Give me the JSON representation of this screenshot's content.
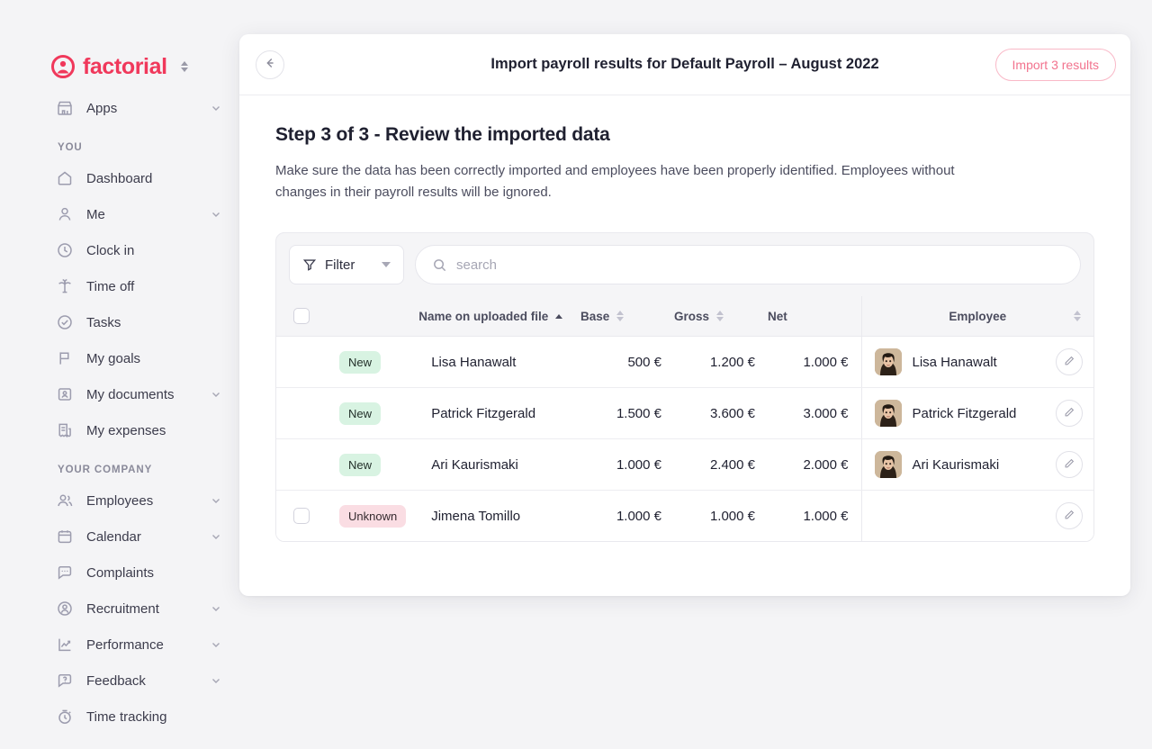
{
  "brand": {
    "name": "factorial",
    "color": "#f0385b",
    "logo_icon": "factorial-circle-person-icon",
    "switcher_icon": "vertical-chevrons-icon"
  },
  "sidebar": {
    "top_items": [
      {
        "label": "Apps",
        "icon": "apps-store-icon",
        "has_chevron": true
      }
    ],
    "sections": [
      {
        "title": "YOU",
        "items": [
          {
            "label": "Dashboard",
            "icon": "home-icon",
            "has_chevron": false
          },
          {
            "label": "Me",
            "icon": "person-icon",
            "has_chevron": true
          },
          {
            "label": "Clock in",
            "icon": "clock-icon",
            "has_chevron": false
          },
          {
            "label": "Time off",
            "icon": "palm-tree-icon",
            "has_chevron": false
          },
          {
            "label": "Tasks",
            "icon": "check-circle-icon",
            "has_chevron": false
          },
          {
            "label": "My goals",
            "icon": "flag-icon",
            "has_chevron": false
          },
          {
            "label": "My documents",
            "icon": "document-person-icon",
            "has_chevron": true
          },
          {
            "label": "My expenses",
            "icon": "receipt-icon",
            "has_chevron": false
          }
        ]
      },
      {
        "title": "YOUR COMPANY",
        "items": [
          {
            "label": "Employees",
            "icon": "people-icon",
            "has_chevron": true
          },
          {
            "label": "Calendar",
            "icon": "calendar-icon",
            "has_chevron": true
          },
          {
            "label": "Complaints",
            "icon": "chat-bubble-icon",
            "has_chevron": false
          },
          {
            "label": "Recruitment",
            "icon": "person-search-icon",
            "has_chevron": true
          },
          {
            "label": "Performance",
            "icon": "chart-line-icon",
            "has_chevron": true
          },
          {
            "label": "Feedback",
            "icon": "question-bubble-icon",
            "has_chevron": true
          },
          {
            "label": "Time tracking",
            "icon": "stopwatch-icon",
            "has_chevron": false
          }
        ]
      }
    ]
  },
  "panel": {
    "back_icon": "arrow-left-icon",
    "title": "Import payroll results for Default Payroll – August 2022",
    "import_button": {
      "label": "Import 3 results",
      "text_color": "#f2738e",
      "border_color": "#f9b8c7"
    },
    "step_title": "Step 3 of 3 - Review the imported data",
    "step_description": "Make sure the data has been correctly imported and employees have been properly identified. Employees without changes in their payroll results will be ignored."
  },
  "toolbar": {
    "filter_label": "Filter",
    "filter_icon": "funnel-icon",
    "filter_caret_icon": "caret-down-icon",
    "search_icon": "search-icon",
    "search_placeholder": "search",
    "search_value": ""
  },
  "table": {
    "select_all_checked": false,
    "columns": [
      {
        "key": "check",
        "label": "",
        "align": "center",
        "sortable": false
      },
      {
        "key": "badge",
        "label": "",
        "align": "left",
        "sortable": false
      },
      {
        "key": "name",
        "label": "Name on uploaded file",
        "align": "left",
        "sortable": true,
        "sort": "asc"
      },
      {
        "key": "base",
        "label": "Base",
        "align": "right",
        "sortable": true,
        "sort": "none"
      },
      {
        "key": "gross",
        "label": "Gross",
        "align": "right",
        "sortable": true,
        "sort": "none"
      },
      {
        "key": "net",
        "label": "Net",
        "align": "right",
        "sortable": true,
        "sort": "none"
      },
      {
        "key": "employee",
        "label": "Employee",
        "align": "center",
        "sortable": true,
        "sort": "none"
      }
    ],
    "rows": [
      {
        "checkbox_visible": false,
        "checked": false,
        "badge": "New",
        "badge_type": "new",
        "name": "Lisa Hanawalt",
        "base": "500 €",
        "gross": "1.200 €",
        "net": "1.000 €",
        "employee_name": "Lisa Hanawalt",
        "has_avatar": true,
        "edit_icon": "pencil-icon"
      },
      {
        "checkbox_visible": false,
        "checked": false,
        "badge": "New",
        "badge_type": "new",
        "name": "Patrick Fitzgerald",
        "base": "1.500 €",
        "gross": "3.600 €",
        "net": "3.000 €",
        "employee_name": "Patrick Fitzgerald",
        "has_avatar": true,
        "edit_icon": "pencil-icon"
      },
      {
        "checkbox_visible": false,
        "checked": false,
        "badge": "New",
        "badge_type": "new",
        "name": "Ari Kaurismaki",
        "base": "1.000 €",
        "gross": "2.400 €",
        "net": "2.000 €",
        "employee_name": "Ari Kaurismaki",
        "has_avatar": true,
        "edit_icon": "pencil-icon"
      },
      {
        "checkbox_visible": true,
        "checked": false,
        "badge": "Unknown",
        "badge_type": "unknown",
        "name": "Jimena Tomillo",
        "base": "1.000 €",
        "gross": "1.000 €",
        "net": "1.000 €",
        "employee_name": "",
        "has_avatar": false,
        "edit_icon": "pencil-icon"
      }
    ]
  },
  "colors": {
    "brand": "#f0385b",
    "badge_new_bg": "#d8f3e2",
    "badge_unknown_bg": "#fadde3",
    "page_bg": "#f4f4f6",
    "panel_bg": "#ffffff"
  }
}
